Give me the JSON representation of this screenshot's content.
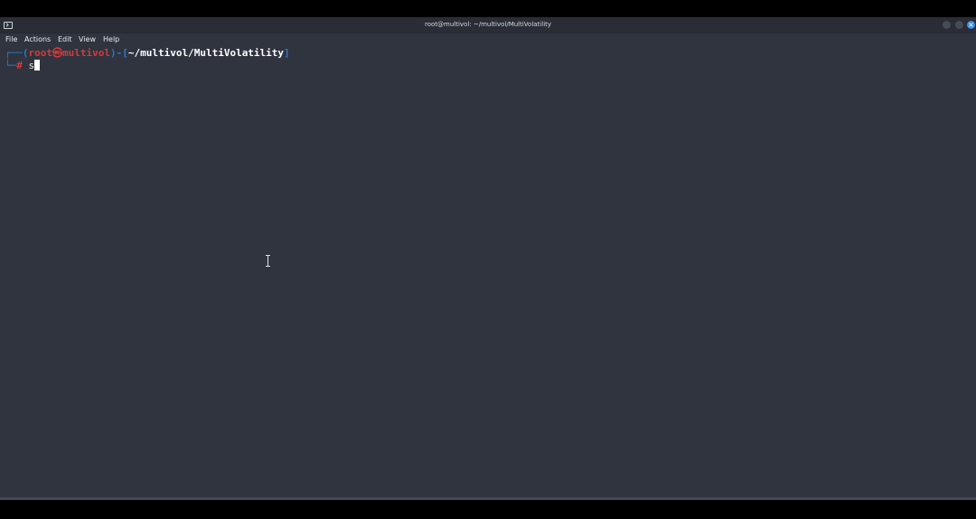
{
  "window": {
    "title": "root@multivol: ~/multivol/MultiVolatility",
    "close_symbol": "×"
  },
  "menu": {
    "items": [
      "File",
      "Actions",
      "Edit",
      "View",
      "Help"
    ]
  },
  "terminal": {
    "line1_corner": "┌──",
    "line1_open_paren": "(",
    "user": "root",
    "at_symbol": "㉿",
    "host": "multivol",
    "line1_close_paren": ")",
    "dash": "-",
    "path_open_bracket": "[",
    "path": "~/multivol/MultiVolatility",
    "path_close_bracket": "]",
    "line2_corner": "└─",
    "prompt_symbol": "#",
    "command": "s"
  },
  "colors": {
    "background": "#2f343f",
    "prompt_blue": "#2f78c9",
    "prompt_red": "#d73a3a",
    "accent_close": "#3d8fe6"
  },
  "icons": [
    "terminal-app-icon",
    "minimize-icon",
    "maximize-icon",
    "close-icon",
    "i-beam-cursor-icon"
  ]
}
